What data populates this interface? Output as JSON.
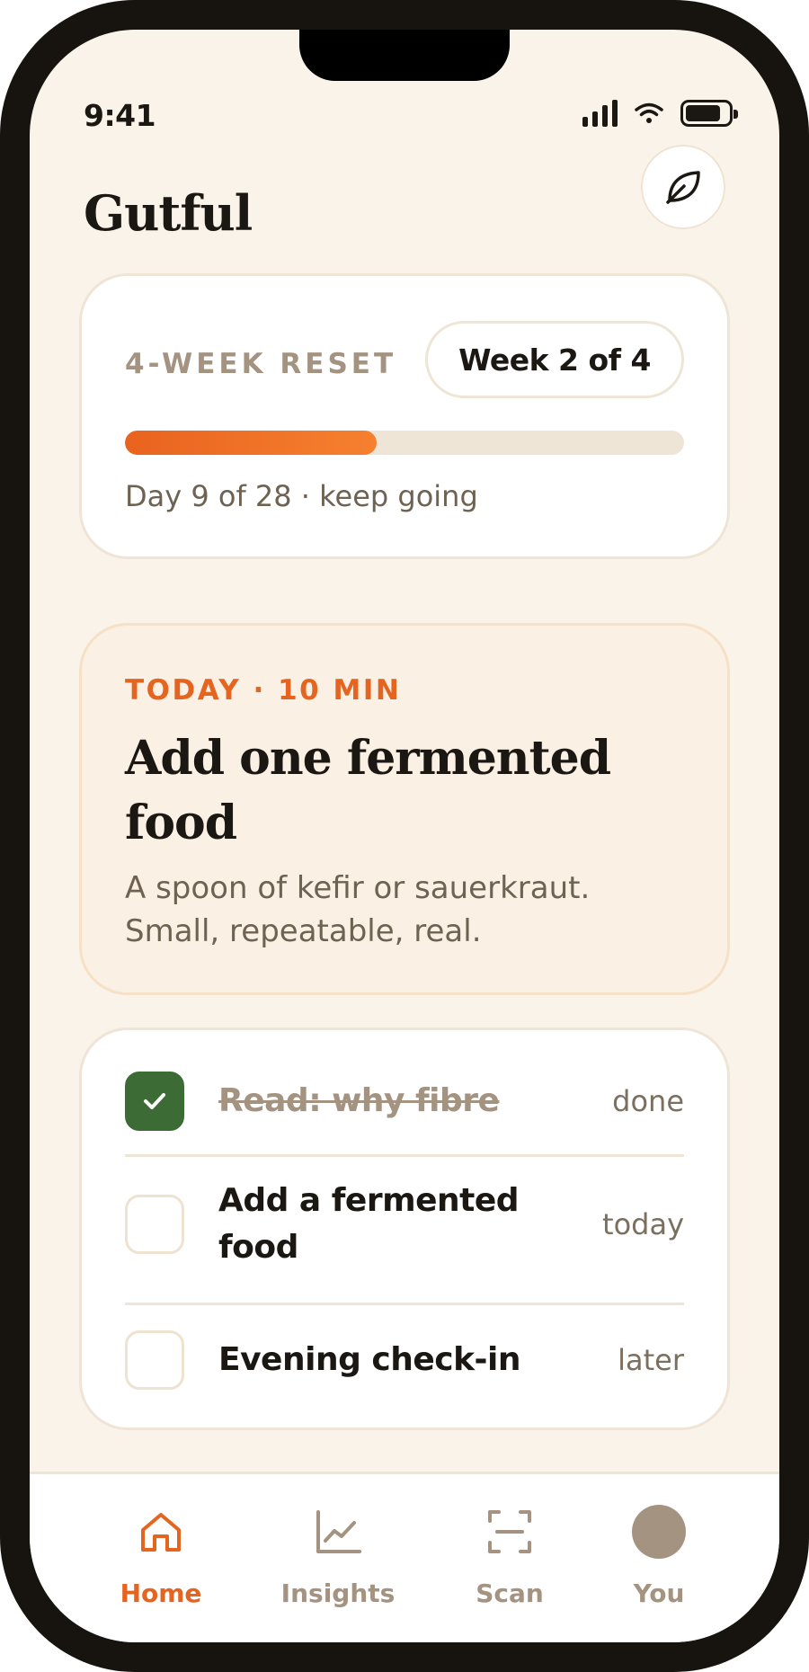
{
  "status_bar": {
    "time": "9:41"
  },
  "header": {
    "title": "Gutful",
    "action_icon": "leaf-icon"
  },
  "program": {
    "eyebrow": "4-WEEK RESET",
    "week_label": "Week 2 of 4",
    "progress_fraction": 0.45,
    "caption": "Day 9 of 28 · keep going"
  },
  "today": {
    "eyebrow": "TODAY · 10 MIN",
    "title": "Add one fermented food",
    "description": "A spoon of kefir or sauerkraut. Small, repeatable, real."
  },
  "tasks": [
    {
      "label": "Read: why fibre",
      "status": "done",
      "checked": true
    },
    {
      "label": "Add a fermented food",
      "status": "today",
      "checked": false
    },
    {
      "label": "Evening check-in",
      "status": "later",
      "checked": false
    }
  ],
  "tabs": [
    {
      "label": "Home",
      "icon": "home-icon",
      "active": true
    },
    {
      "label": "Insights",
      "icon": "chart-icon",
      "active": false
    },
    {
      "label": "Scan",
      "icon": "scan-icon",
      "active": false
    },
    {
      "label": "You",
      "icon": "avatar",
      "active": false
    }
  ],
  "colors": {
    "accent": "#e5641f",
    "success": "#3d6b36",
    "background": "#faf3e9",
    "muted": "#a39380"
  }
}
